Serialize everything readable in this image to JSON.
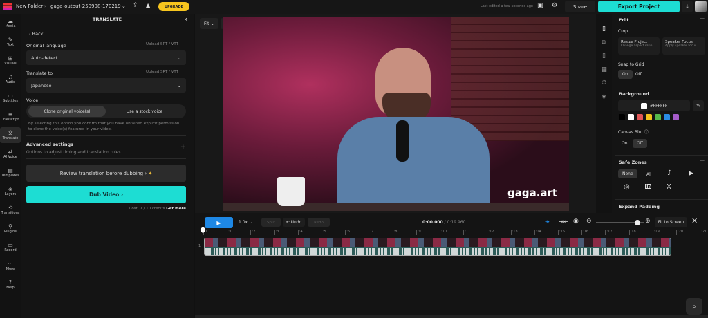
{
  "topbar": {
    "folder": "New Folder",
    "project": "gaga-output-250908-170219",
    "upgrade": "UPGRADE",
    "last_edited": "Last edited a few seconds ago",
    "share": "Share",
    "export": "Export Project"
  },
  "rail": [
    {
      "label": "Media",
      "icon": "☁"
    },
    {
      "label": "Text",
      "icon": "✎"
    },
    {
      "label": "Visuals",
      "icon": "⊞"
    },
    {
      "label": "Audio",
      "icon": "♫"
    },
    {
      "label": "Subtitles",
      "icon": "▭"
    },
    {
      "label": "Transcript",
      "icon": "≡"
    },
    {
      "label": "Translate",
      "icon": "文"
    },
    {
      "label": "AI Voice",
      "icon": "⇄"
    },
    {
      "label": "Templates",
      "icon": "▤"
    },
    {
      "label": "Layers",
      "icon": "◈"
    },
    {
      "label": "Transitions",
      "icon": "⟲"
    },
    {
      "label": "Plugins",
      "icon": "⚲"
    },
    {
      "label": "Record",
      "icon": "▭"
    },
    {
      "label": "More",
      "icon": "···"
    },
    {
      "label": "Help",
      "icon": "?"
    }
  ],
  "panel": {
    "title": "TRANSLATE",
    "back": "Back",
    "orig_label": "Original language",
    "upload": "Upload SRT / VTT",
    "orig_value": "Auto-detect",
    "to_label": "Translate to",
    "to_value": "Japanese",
    "voice_label": "Voice",
    "voice_clone": "Clone original voice(s)",
    "voice_stock": "Use a stock voice",
    "consent": "By selecting this option you confirm that you have obtained explicit permission to clone the voice(s) featured in your video.",
    "adv_title": "Advanced settings",
    "adv_desc": "Options to adjust timing and translation rules",
    "review": "Review translation before dubbing",
    "dub": "Dub Video",
    "cost": "Cost: 7 / 10 credits",
    "get_more": "Get more"
  },
  "preview": {
    "fit": "Fit",
    "watermark": "gaga.art"
  },
  "right": {
    "edit": "Edit",
    "crop": "Crop",
    "resize": "Resize Project",
    "resize_sub": "Change aspect ratio",
    "speaker": "Speaker Focus",
    "speaker_sub": "Apply speaker focus",
    "snap": "Snap to Grid",
    "on": "On",
    "off": "Off",
    "background": "Background",
    "hex": "#FFFFFF",
    "swatches": [
      "#000000",
      "#FFFFFF",
      "#E05555",
      "#F2C21B",
      "#55B94A",
      "#2A8CE6",
      "#A55BC9"
    ],
    "canvas_blur": "Canvas Blur",
    "safe_zones": "Safe Zones",
    "none": "None",
    "all": "All",
    "expand": "Expand Padding"
  },
  "timeline": {
    "speed": "1.0x",
    "split": "Split",
    "undo": "Undo",
    "redo": "Redo",
    "time": "0:00.000",
    "duration": "0:19.960",
    "fit": "Fit to Screen",
    "zoom_level": 0.85,
    "track": "1",
    "ticks": [
      "0",
      ":1",
      ":2",
      ":3",
      ":4",
      ":5",
      ":6",
      ":7",
      ":8",
      ":9",
      ":10",
      ":11",
      ":12",
      ":13",
      ":14",
      ":15",
      ":16",
      ":17",
      ":18",
      ":19",
      ":20",
      ":21"
    ]
  },
  "colors": {
    "accent": "#1DDDD3",
    "play": "#1E88E5",
    "upgrade": "#F7C51E"
  }
}
